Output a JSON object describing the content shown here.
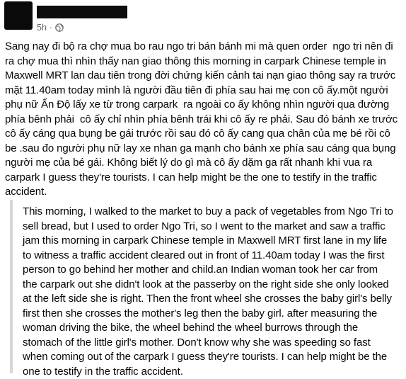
{
  "post": {
    "timestamp": "5h",
    "separator": "·",
    "audience_icon": "globe-icon",
    "body": "Sang nay đi bộ ra chợ mua bo rau ngo tri bán bánh mi mà quen order  ngo tri nên đi\nra chợ mua thì nhìn thấy nan giao thông this morning in carpark Chinese temple in\nMaxwell MRT lan dau tiên trong đời chứng kiến cảnh tai nạn giao thông say ra trước\nmặt 11.40am today mình là người đầu tiên đi phía sau hai mẹ con cô ấy.một người\nphụ nữ Ấn Độ lấy xe từ trong carpark  ra ngoài co ấy không nhìn người qua đường\nphía bênh phải  cô ấy chỉ nhìn phía bênh trái khi cô ấy re phải. Sau đó bánh xe trước\ncô ấy cáng qua bụng be gái trước rồi sau đó cô ấy cang qua chân của mẹ bé rồi cô\nbe .sau đo người phụ nữ lay xe nhan ga mạnh cho bánh xe phía sau cáng qua bụng\nngười mẹ của bé gái. Không biết lý do gì mà cô ấy dặm ga rất nhanh khi vua ra\ncarpark I guess they're tourists. I can help might be the one to testify in the traffic\naccident.",
    "quote": "This morning, I walked to the market to buy a pack of vegetables from Ngo Tri to\nsell bread, but I used to order Ngo Tri, so I went to the market and saw a traffic\njam this morning in carpark Chinese temple in Maxwell MRT first lane in my life\nto witness a traffic accident cleared out in front of 11.40am today I was the first\nperson to go behind her mother and child.an Indian woman took her car from\nthe carpark out she didn't look at the passerby on the right side she only looked\nat the left side she is right. Then the front wheel she crosses the baby girl's belly\nfirst then she crosses the mother's leg then the baby girl. after measuring the\nwoman driving the bike, the wheel behind the wheel burrows through the\nstomach of the little girl's mother. Don't know why she was speeding so fast\nwhen coming out of the carpark I guess they're tourists. I can help might be the\none to testify in the traffic accident."
  }
}
